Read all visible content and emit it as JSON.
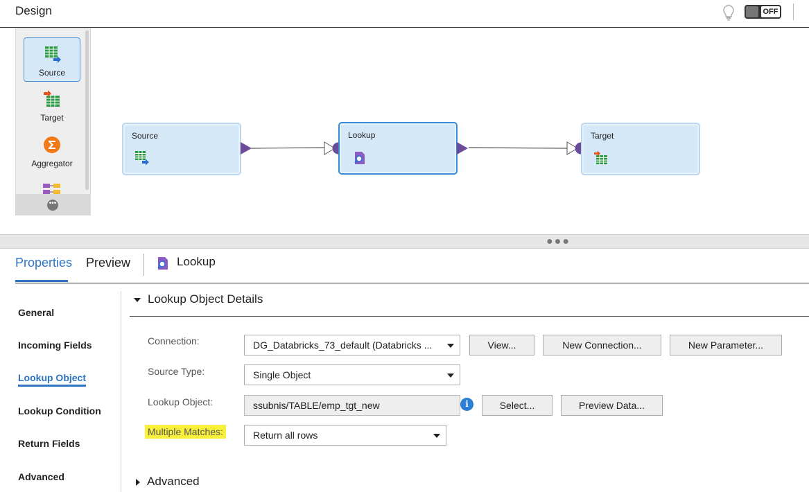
{
  "header": {
    "title": "Design",
    "toggle_label": "OFF"
  },
  "palette": {
    "items": [
      {
        "label": "Source",
        "icon": "source-table-icon"
      },
      {
        "label": "Target",
        "icon": "target-table-icon"
      },
      {
        "label": "Aggregator",
        "icon": "sigma-icon"
      }
    ],
    "more_icon": "more-dots-icon"
  },
  "nodes": [
    {
      "label": "Source",
      "icon": "source-table-icon"
    },
    {
      "label": "Lookup",
      "icon": "lookup-icon"
    },
    {
      "label": "Target",
      "icon": "target-table-icon"
    }
  ],
  "tabs": [
    {
      "label": "Properties"
    },
    {
      "label": "Preview"
    }
  ],
  "selected_object": {
    "name": "Lookup",
    "icon": "lookup-icon"
  },
  "sidenav": {
    "items": [
      {
        "label": "General"
      },
      {
        "label": "Incoming Fields"
      },
      {
        "label": "Lookup Object"
      },
      {
        "label": "Lookup Condition"
      },
      {
        "label": "Return Fields"
      },
      {
        "label": "Advanced"
      }
    ]
  },
  "section": {
    "title": "Lookup Object Details",
    "advanced_title": "Advanced"
  },
  "form": {
    "connection": {
      "label": "Connection:",
      "value": "DG_Databricks_73_default (Databricks ..."
    },
    "source_type": {
      "label": "Source Type:",
      "value": "Single Object"
    },
    "lookup_object": {
      "label": "Lookup Object:",
      "value": "ssubnis/TABLE/emp_tgt_new"
    },
    "multiple_matches": {
      "label": "Multiple Matches:",
      "value": "Return all rows"
    }
  },
  "buttons": {
    "view": "View...",
    "new_connection": "New Connection...",
    "new_parameter": "New Parameter...",
    "select": "Select...",
    "preview_data": "Preview Data..."
  },
  "colors": {
    "accent": "#2e74c4",
    "node_fill": "#d5e8f8",
    "port": "#6b4c9a",
    "highlight": "#f8f03a"
  }
}
